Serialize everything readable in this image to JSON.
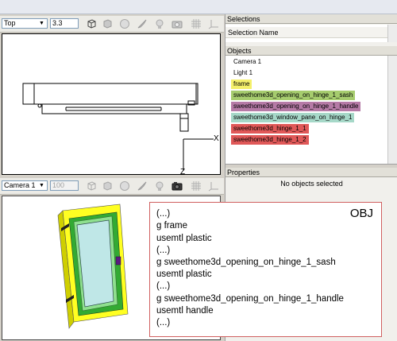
{
  "top_view": {
    "mode": "Top",
    "zoom": "3.3"
  },
  "camera_view": {
    "mode": "Camera 1",
    "zoom": "100"
  },
  "axis_labels": {
    "x": "X",
    "z": "Z"
  },
  "selections": {
    "header": "Selections",
    "column": "Selection Name"
  },
  "objects": {
    "header": "Objects",
    "items": [
      {
        "label": "Camera 1",
        "color": ""
      },
      {
        "label": "Light 1",
        "color": ""
      },
      {
        "label": "frame",
        "color": "#f4f06a"
      },
      {
        "label": "sweethome3d_opening_on_hinge_1_sash",
        "color": "#a6cc6e"
      },
      {
        "label": "sweethome3d_opening_on_hinge_1_handle",
        "color": "#b57aa6"
      },
      {
        "label": "sweethome3d_window_pane_on_hinge_1",
        "color": "#a6d8c8"
      },
      {
        "label": "sweethome3d_hinge_1_1",
        "color": "#e05858"
      },
      {
        "label": "sweethome3d_hinge_1_2",
        "color": "#e05858"
      }
    ]
  },
  "properties": {
    "header": "Properties",
    "empty": "No objects selected"
  },
  "obj_file": {
    "tag": "OBJ",
    "lines": [
      "(...)",
      "g frame",
      "usemtl plastic",
      "(...)",
      "g sweethome3d_opening_on_hinge_1_sash",
      "usemtl plastic",
      "(...)",
      "g  sweethome3d_opening_on_hinge_1_handle",
      "usemtl handle",
      "(...)"
    ]
  }
}
